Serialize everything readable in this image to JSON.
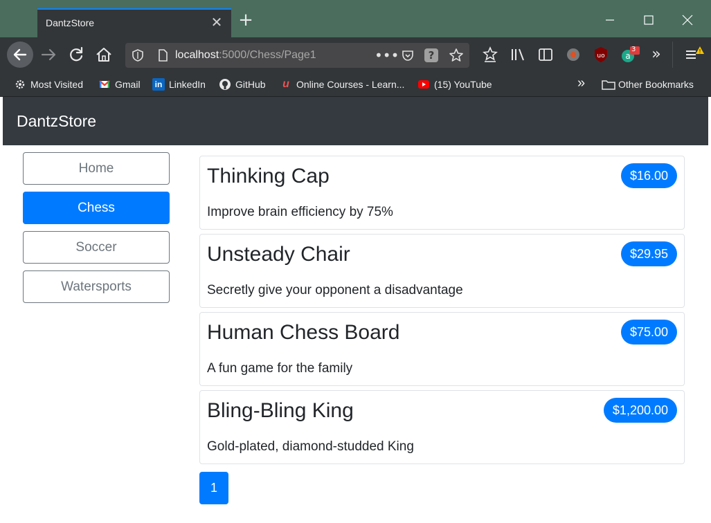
{
  "browser": {
    "tab_title": "DantzStore",
    "url_host": "localhost",
    "url_path": ":5000/Chess/Page1",
    "bookmarks": [
      {
        "label": "Most Visited"
      },
      {
        "label": "Gmail"
      },
      {
        "label": "LinkedIn"
      },
      {
        "label": "GitHub"
      },
      {
        "label": "Online Courses - Learn..."
      },
      {
        "label": "(15) YouTube"
      },
      {
        "label": "Other Bookmarks"
      }
    ],
    "extension_badge": "3"
  },
  "site": {
    "brand": "DantzStore",
    "categories": [
      {
        "label": "Home",
        "active": false
      },
      {
        "label": "Chess",
        "active": true
      },
      {
        "label": "Soccer",
        "active": false
      },
      {
        "label": "Watersports",
        "active": false
      }
    ],
    "products": [
      {
        "name": "Thinking Cap",
        "price": "$16.00",
        "description": "Improve brain efficiency by 75%"
      },
      {
        "name": "Unsteady Chair",
        "price": "$29.95",
        "description": "Secretly give your opponent a disadvantage"
      },
      {
        "name": "Human Chess Board",
        "price": "$75.00",
        "description": "A fun game for the family"
      },
      {
        "name": "Bling-Bling King",
        "price": "$1,200.00",
        "description": "Gold-plated, diamond-studded King"
      }
    ],
    "pagination": {
      "current": "1"
    }
  },
  "colors": {
    "primary": "#007bff",
    "header_bg": "#343a40",
    "secondary": "#6c757d",
    "titlebar": "#4a6d5e"
  }
}
